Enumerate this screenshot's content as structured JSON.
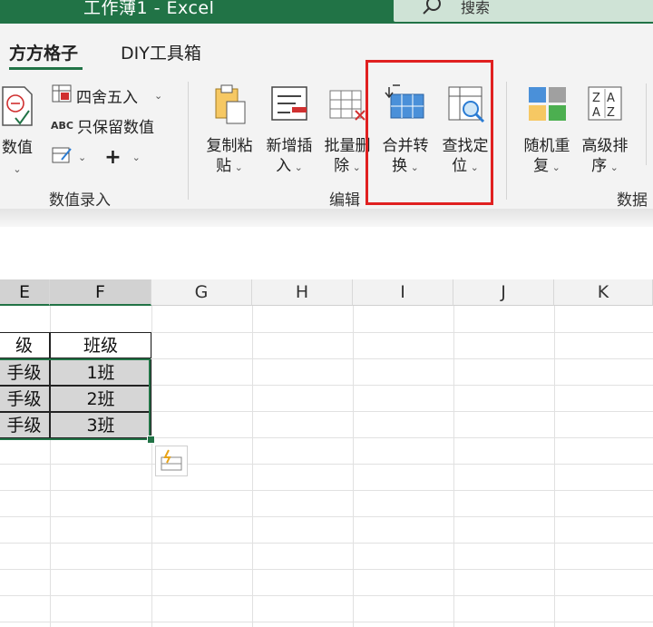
{
  "window": {
    "title": "工作薄1  -  Excel",
    "search_placeholder": "搜索"
  },
  "tabs": [
    {
      "label": "方方格子",
      "active": true
    },
    {
      "label": "DIY工具箱",
      "active": false
    }
  ],
  "ribbon": {
    "value_entry": {
      "big_button": {
        "label": "数值"
      },
      "round_label": "四舍五入",
      "keep_values_label": "只保留数值",
      "abc_glyph": "ABC",
      "plus_glyph": "+",
      "group_label": "数值录入"
    },
    "edit": {
      "buttons": [
        {
          "line1": "复制粘",
          "line2": "贴"
        },
        {
          "line1": "新增插",
          "line2": "入"
        },
        {
          "line1": "批量删",
          "line2": "除"
        },
        {
          "line1": "合并转",
          "line2": "换"
        },
        {
          "line1": "查找定",
          "line2": "位"
        }
      ],
      "group_label": "编辑"
    },
    "data": {
      "buttons": [
        {
          "line1": "随机重",
          "line2": "复"
        },
        {
          "line1": "高级排",
          "line2": "序"
        }
      ],
      "group_label": "数据"
    }
  },
  "sheet": {
    "columns": [
      "E",
      "F",
      "G",
      "H",
      "I",
      "J",
      "K"
    ],
    "rows": [
      {
        "e": "级",
        "f": "班级"
      },
      {
        "e": "手级",
        "f": "1班"
      },
      {
        "e": "手级",
        "f": "2班"
      },
      {
        "e": "手级",
        "f": "3班"
      }
    ]
  },
  "colors": {
    "brand_green": "#217346",
    "highlight_red": "#e02020",
    "selection_gray": "#d6d6d6"
  }
}
